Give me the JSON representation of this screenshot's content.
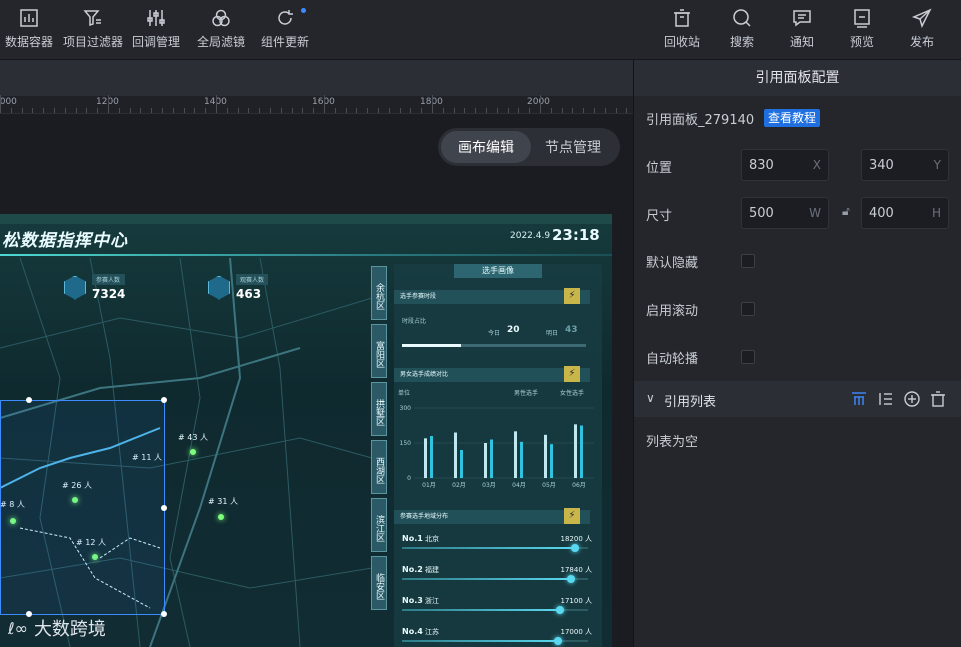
{
  "toolbar": {
    "left": [
      {
        "label": "数据容器",
        "icon": "chart-icon"
      },
      {
        "label": "项目过滤器",
        "icon": "filter-icon"
      },
      {
        "label": "回调管理",
        "icon": "sliders-icon"
      },
      {
        "label": "全局滤镜",
        "icon": "circles-icon"
      },
      {
        "label": "组件更新",
        "icon": "refresh-icon"
      }
    ],
    "right": [
      {
        "label": "回收站",
        "icon": "trash-icon"
      },
      {
        "label": "搜索",
        "icon": "search-icon"
      },
      {
        "label": "通知",
        "icon": "message-icon"
      },
      {
        "label": "预览",
        "icon": "preview-icon"
      },
      {
        "label": "发布",
        "icon": "send-icon"
      }
    ]
  },
  "ruler": {
    "labels": [
      "1000",
      "1200",
      "1400",
      "1600",
      "1800",
      "2000"
    ]
  },
  "mode": {
    "active": "画布编辑",
    "inactive": "节点管理"
  },
  "dashboard": {
    "title": "松数据指挥中心",
    "date": "2022.4.9",
    "time": "23:18",
    "stats": [
      {
        "label": "参赛人数",
        "value": "7324"
      },
      {
        "label": "观赛人数",
        "value": "463"
      }
    ],
    "map_labels": [
      "# 11 人",
      "# 43 人",
      "# 26 人",
      "# 8 人",
      "# 31 人",
      "# 12 人"
    ],
    "districts": [
      "余杭区",
      "富阳区",
      "拱墅区",
      "西湖区",
      "滨江区",
      "临安区"
    ],
    "panel": {
      "title": "选手画像",
      "section1": "选手参赛时段",
      "time_share": "时段占比",
      "today_label": "今日",
      "today_value": "20",
      "tomorrow_label": "明日",
      "tomorrow_value": "43",
      "section2": "男女选手成绩对比",
      "unit": "单位",
      "legend_male": "男性选手",
      "legend_female": "女性选手",
      "section3": "参赛选手地域分布",
      "person_unit": "人"
    },
    "watermark": "大数跨境"
  },
  "chart_data": {
    "type": "bar",
    "categories": [
      "01月",
      "02月",
      "03月",
      "04月",
      "05月",
      "06月"
    ],
    "series": [
      {
        "name": "男性选手",
        "values": [
          170,
          195,
          150,
          200,
          185,
          230
        ]
      },
      {
        "name": "女性选手",
        "values": [
          180,
          120,
          165,
          155,
          145,
          225
        ]
      }
    ],
    "ylabel": "单位",
    "yticks": [
      "0",
      "150",
      "300"
    ],
    "ylim": [
      0,
      300
    ]
  },
  "ranking": [
    {
      "rank": "No.1",
      "region": "北京",
      "value": "18200",
      "fill": 0.93
    },
    {
      "rank": "No.2",
      "region": "福建",
      "value": "17840",
      "fill": 0.91
    },
    {
      "rank": "No.3",
      "region": "浙江",
      "value": "17100",
      "fill": 0.85
    },
    {
      "rank": "No.4",
      "region": "江苏",
      "value": "17000",
      "fill": 0.84
    }
  ],
  "config": {
    "header": "引用面板配置",
    "panel_name": "引用面板_279140",
    "tutorial_btn": "查看教程",
    "position_label": "位置",
    "pos_x": "830",
    "pos_x_unit": "X",
    "pos_y": "340",
    "pos_y_unit": "Y",
    "size_label": "尺寸",
    "width": "500",
    "width_unit": "W",
    "height": "400",
    "height_unit": "H",
    "hidden_label": "默认隐藏",
    "scroll_label": "启用滚动",
    "autoplay_label": "自动轮播",
    "list_title": "引用列表",
    "list_empty": "列表为空"
  }
}
